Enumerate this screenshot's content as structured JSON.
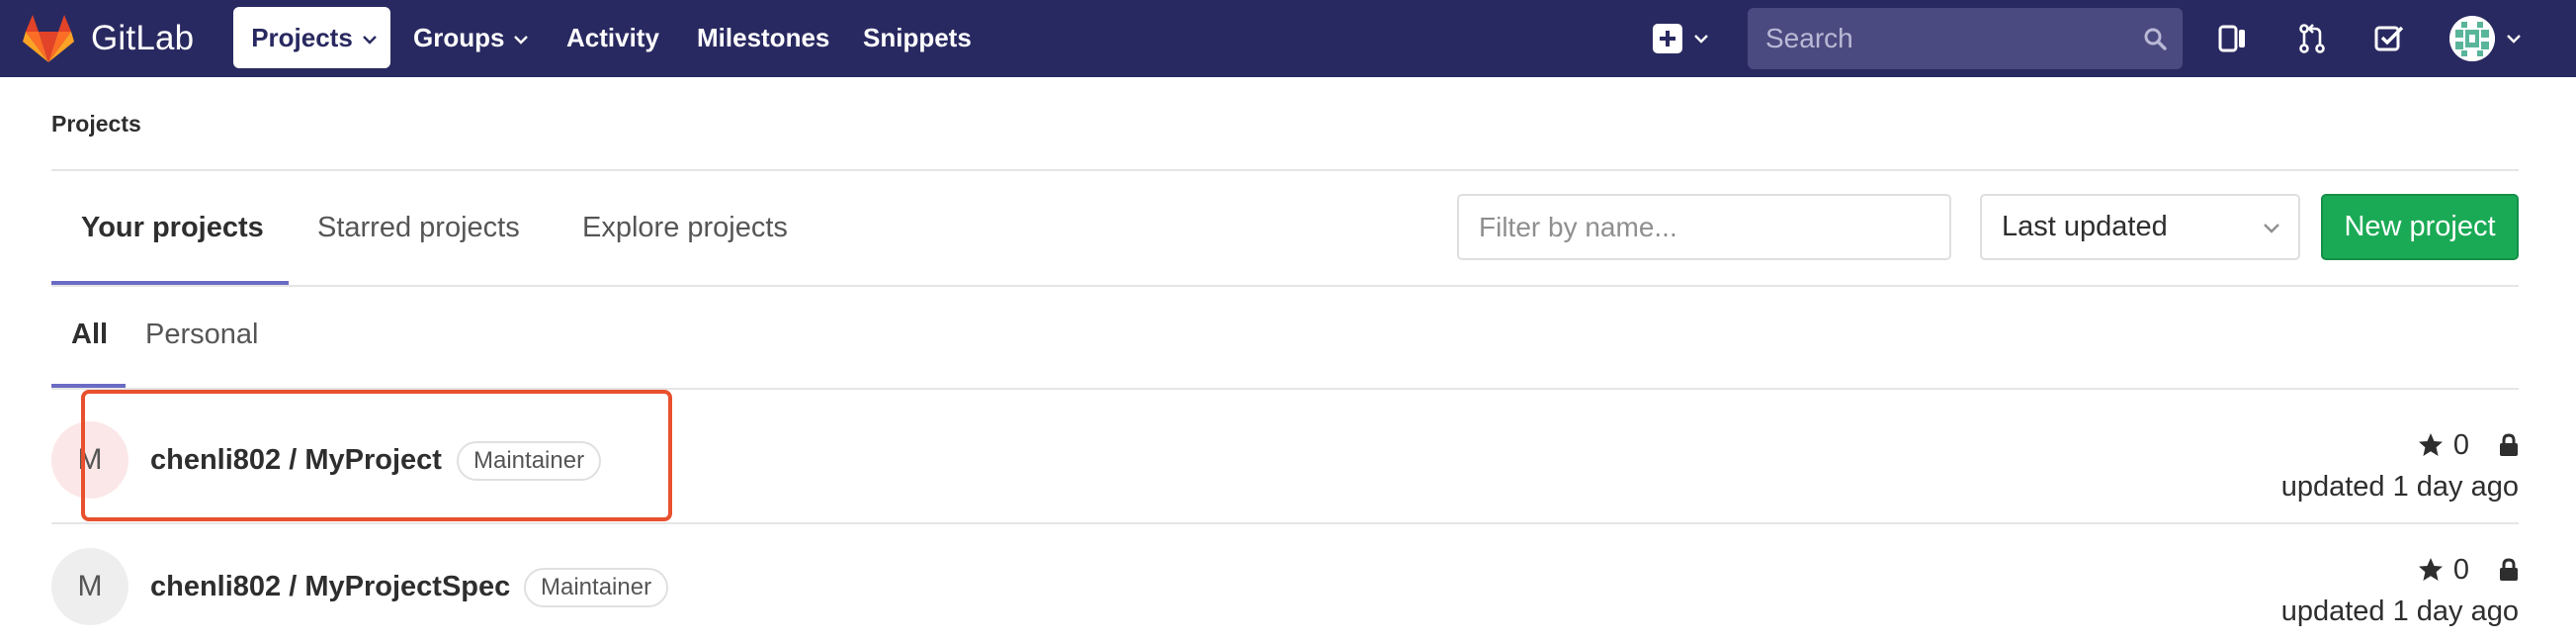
{
  "navbar": {
    "brand": "GitLab",
    "items": [
      {
        "label": "Projects",
        "has_dropdown": true,
        "active": true
      },
      {
        "label": "Groups",
        "has_dropdown": true
      },
      {
        "label": "Activity"
      },
      {
        "label": "Milestones"
      },
      {
        "label": "Snippets"
      }
    ],
    "search_placeholder": "Search",
    "icons": [
      "gitlab-logo-icon",
      "plus-square-icon",
      "search-icon",
      "todos-panel-icon",
      "merge-request-icon",
      "todo-check-icon",
      "user-avatar-icon"
    ],
    "colors": {
      "background": "#292961",
      "search_bg": "#4a4a80"
    }
  },
  "breadcrumb": "Projects",
  "tabs": [
    {
      "label": "Your projects",
      "active": true
    },
    {
      "label": "Starred projects"
    },
    {
      "label": "Explore projects"
    }
  ],
  "filter_placeholder": "Filter by name...",
  "sort_selected": "Last updated",
  "new_project_label": "New project",
  "subfilter": [
    {
      "label": "All",
      "active": true
    },
    {
      "label": "Personal"
    }
  ],
  "projects": [
    {
      "avatar_letter": "M",
      "name": "chenli802 / MyProject",
      "role": "Maintainer",
      "stars": "0",
      "updated": "updated 1 day ago",
      "highlighted": true
    },
    {
      "avatar_letter": "M",
      "name": "chenli802 / MyProjectSpec",
      "role": "Maintainer",
      "stars": "0",
      "updated": "updated 1 day ago"
    }
  ],
  "colors": {
    "accent": "#6b6bc5",
    "new_project_button": "#1aaa55",
    "highlight": "#e8502e"
  }
}
